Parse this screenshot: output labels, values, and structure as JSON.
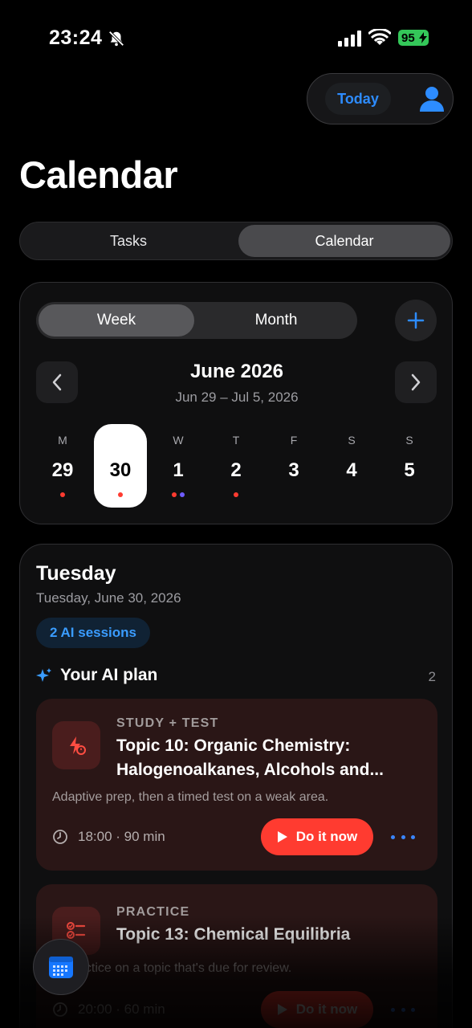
{
  "status": {
    "time": "23:24",
    "battery": "95"
  },
  "header": {
    "today_label": "Today",
    "title": "Calendar"
  },
  "segment": {
    "tasks": "Tasks",
    "calendar": "Calendar"
  },
  "calendar": {
    "week_label": "Week",
    "month_label": "Month",
    "month_title": "June 2026",
    "range": "Jun 29 – Jul 5, 2026",
    "days": [
      {
        "name": "M",
        "num": "29"
      },
      {
        "name": "",
        "num": "30"
      },
      {
        "name": "W",
        "num": "1"
      },
      {
        "name": "T",
        "num": "2"
      },
      {
        "name": "F",
        "num": "3"
      },
      {
        "name": "S",
        "num": "4"
      },
      {
        "name": "S",
        "num": "5"
      }
    ]
  },
  "day": {
    "title": "Tuesday",
    "date": "Tuesday, June 30, 2026",
    "badge": "2 AI sessions",
    "plan_label": "Your AI plan",
    "plan_count": "2",
    "tasks": [
      {
        "kind": "STUDY + TEST",
        "name": "Topic 10: Organic Chemistry: Halogenoalkanes, Alcohols and...",
        "desc": "Adaptive prep, then a timed test on a weak area.",
        "meta": "18:00 · 90 min",
        "cta": "Do it now"
      },
      {
        "kind": "PRACTICE",
        "name": "Topic 13: Chemical Equilibria",
        "desc": "... practice on a topic that's due for review.",
        "meta": "20:00 · 60 min",
        "cta": "Do it now"
      }
    ]
  },
  "colors": {
    "accent": "#2d8cff",
    "danger": "#ff3b30",
    "dot_red": "#ff3b30",
    "dot_purple": "#6e5cff"
  }
}
